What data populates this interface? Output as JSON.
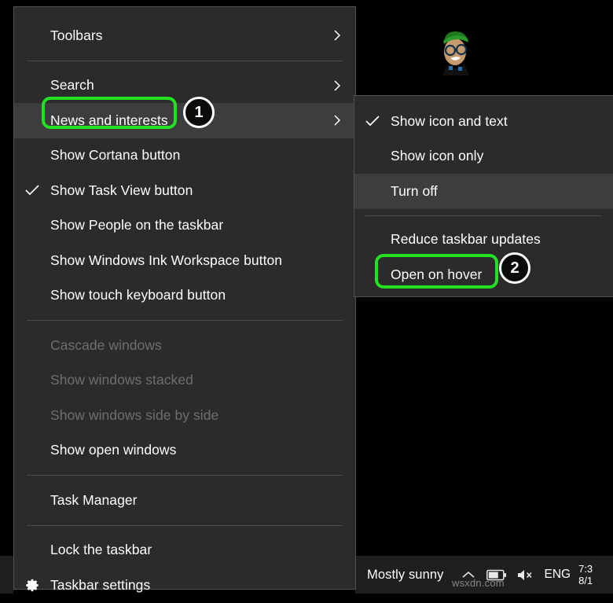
{
  "desktop": {
    "background_color": "#000000",
    "avatar_alt": "cartoon-avatar"
  },
  "main_menu": {
    "name": "taskbar-context-menu",
    "background_color": "#2b2b2b",
    "items": [
      {
        "label": "Toolbars",
        "glyph": "",
        "submenu": true,
        "disabled": false,
        "highlight": false,
        "separator_after": true
      },
      {
        "label": "Search",
        "glyph": "",
        "submenu": true,
        "disabled": false,
        "highlight": false,
        "separator_after": false
      },
      {
        "label": "News and interests",
        "glyph": "",
        "submenu": true,
        "disabled": false,
        "highlight": true,
        "separator_after": false
      },
      {
        "label": "Show Cortana button",
        "glyph": "",
        "submenu": false,
        "disabled": false,
        "highlight": false,
        "separator_after": false
      },
      {
        "label": "Show Task View button",
        "glyph": "check",
        "submenu": false,
        "disabled": false,
        "highlight": false,
        "separator_after": false
      },
      {
        "label": "Show People on the taskbar",
        "glyph": "",
        "submenu": false,
        "disabled": false,
        "highlight": false,
        "separator_after": false
      },
      {
        "label": "Show Windows Ink Workspace button",
        "glyph": "",
        "submenu": false,
        "disabled": false,
        "highlight": false,
        "separator_after": false
      },
      {
        "label": "Show touch keyboard button",
        "glyph": "",
        "submenu": false,
        "disabled": false,
        "highlight": false,
        "separator_after": true
      },
      {
        "label": "Cascade windows",
        "glyph": "",
        "submenu": false,
        "disabled": true,
        "highlight": false,
        "separator_after": false
      },
      {
        "label": "Show windows stacked",
        "glyph": "",
        "submenu": false,
        "disabled": true,
        "highlight": false,
        "separator_after": false
      },
      {
        "label": "Show windows side by side",
        "glyph": "",
        "submenu": false,
        "disabled": true,
        "highlight": false,
        "separator_after": false
      },
      {
        "label": "Show open windows",
        "glyph": "",
        "submenu": false,
        "disabled": false,
        "highlight": false,
        "separator_after": true
      },
      {
        "label": "Task Manager",
        "glyph": "",
        "submenu": false,
        "disabled": false,
        "highlight": false,
        "separator_after": true
      },
      {
        "label": "Lock the taskbar",
        "glyph": "",
        "submenu": false,
        "disabled": false,
        "highlight": false,
        "separator_after": false
      },
      {
        "label": "Taskbar settings",
        "glyph": "gear",
        "submenu": false,
        "disabled": false,
        "highlight": false,
        "separator_after": false
      }
    ]
  },
  "sub_menu": {
    "name": "news-and-interests-submenu",
    "items": [
      {
        "label": "Show icon and text",
        "glyph": "check",
        "disabled": false,
        "highlight": false,
        "separator_after": false
      },
      {
        "label": "Show icon only",
        "glyph": "",
        "disabled": false,
        "highlight": false,
        "separator_after": false
      },
      {
        "label": "Turn off",
        "glyph": "",
        "disabled": false,
        "highlight": true,
        "separator_after": true
      },
      {
        "label": "Reduce taskbar updates",
        "glyph": "",
        "disabled": false,
        "highlight": false,
        "separator_after": false
      },
      {
        "label": "Open on hover",
        "glyph": "",
        "disabled": false,
        "highlight": false,
        "separator_after": false
      }
    ]
  },
  "annotations": {
    "highlight_color": "#22e022",
    "badges": [
      {
        "label": "1",
        "target": "News and interests"
      },
      {
        "label": "2",
        "target": "Open on hover"
      }
    ]
  },
  "taskbar": {
    "background_color": "#1f1f1f",
    "weather": "Mostly sunny",
    "language": "ENG",
    "clock_time": "7:3",
    "clock_date": "8/1",
    "icons": [
      "chevron-up-icon",
      "battery-icon",
      "volume-muted-icon"
    ]
  },
  "watermark": {
    "text": "wsxdn.com"
  }
}
